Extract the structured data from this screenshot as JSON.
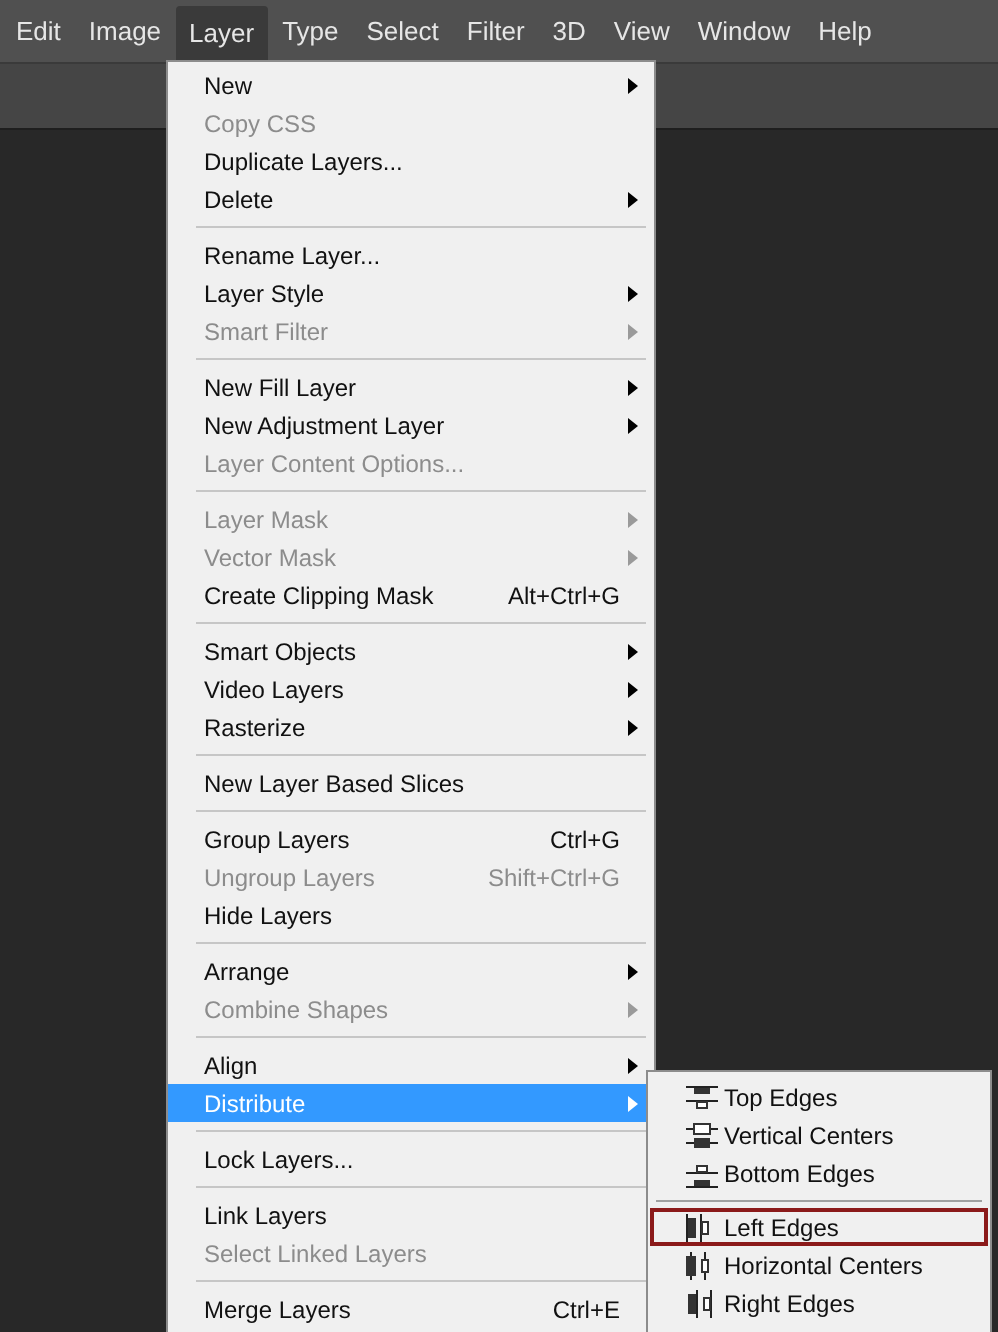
{
  "menubar": [
    {
      "label": "Edit",
      "selected": false
    },
    {
      "label": "Image",
      "selected": false
    },
    {
      "label": "Layer",
      "selected": true
    },
    {
      "label": "Type",
      "selected": false
    },
    {
      "label": "Select",
      "selected": false
    },
    {
      "label": "Filter",
      "selected": false
    },
    {
      "label": "3D",
      "selected": false
    },
    {
      "label": "View",
      "selected": false
    },
    {
      "label": "Window",
      "selected": false
    },
    {
      "label": "Help",
      "selected": false
    }
  ],
  "layer_menu": {
    "groups": [
      [
        {
          "label": "New",
          "disabled": false,
          "submenu": true,
          "selected": false
        },
        {
          "label": "Copy CSS",
          "disabled": true,
          "submenu": false,
          "selected": false
        },
        {
          "label": "Duplicate Layers...",
          "disabled": false,
          "submenu": false,
          "selected": false
        },
        {
          "label": "Delete",
          "disabled": false,
          "submenu": true,
          "selected": false
        }
      ],
      [
        {
          "label": "Rename Layer...",
          "disabled": false,
          "submenu": false,
          "selected": false
        },
        {
          "label": "Layer Style",
          "disabled": false,
          "submenu": true,
          "selected": false
        },
        {
          "label": "Smart Filter",
          "disabled": true,
          "submenu": true,
          "selected": false
        }
      ],
      [
        {
          "label": "New Fill Layer",
          "disabled": false,
          "submenu": true,
          "selected": false
        },
        {
          "label": "New Adjustment Layer",
          "disabled": false,
          "submenu": true,
          "selected": false
        },
        {
          "label": "Layer Content Options...",
          "disabled": true,
          "submenu": false,
          "selected": false
        }
      ],
      [
        {
          "label": "Layer Mask",
          "disabled": true,
          "submenu": true,
          "selected": false
        },
        {
          "label": "Vector Mask",
          "disabled": true,
          "submenu": true,
          "selected": false
        },
        {
          "label": "Create Clipping Mask",
          "disabled": false,
          "submenu": false,
          "shortcut": "Alt+Ctrl+G",
          "selected": false
        }
      ],
      [
        {
          "label": "Smart Objects",
          "disabled": false,
          "submenu": true,
          "selected": false
        },
        {
          "label": "Video Layers",
          "disabled": false,
          "submenu": true,
          "selected": false
        },
        {
          "label": "Rasterize",
          "disabled": false,
          "submenu": true,
          "selected": false
        }
      ],
      [
        {
          "label": "New Layer Based Slices",
          "disabled": false,
          "submenu": false,
          "selected": false
        }
      ],
      [
        {
          "label": "Group Layers",
          "disabled": false,
          "submenu": false,
          "shortcut": "Ctrl+G",
          "selected": false
        },
        {
          "label": "Ungroup Layers",
          "disabled": true,
          "submenu": false,
          "shortcut": "Shift+Ctrl+G",
          "selected": false
        },
        {
          "label": "Hide Layers",
          "disabled": false,
          "submenu": false,
          "selected": false
        }
      ],
      [
        {
          "label": "Arrange",
          "disabled": false,
          "submenu": true,
          "selected": false
        },
        {
          "label": "Combine Shapes",
          "disabled": true,
          "submenu": true,
          "selected": false
        }
      ],
      [
        {
          "label": "Align",
          "disabled": false,
          "submenu": true,
          "selected": false
        },
        {
          "label": "Distribute",
          "disabled": false,
          "submenu": true,
          "selected": true
        }
      ],
      [
        {
          "label": "Lock Layers...",
          "disabled": false,
          "submenu": false,
          "selected": false
        }
      ],
      [
        {
          "label": "Link Layers",
          "disabled": false,
          "submenu": false,
          "selected": false
        },
        {
          "label": "Select Linked Layers",
          "disabled": true,
          "submenu": false,
          "selected": false
        }
      ],
      [
        {
          "label": "Merge Layers",
          "disabled": false,
          "submenu": false,
          "shortcut": "Ctrl+E",
          "selected": false
        }
      ]
    ]
  },
  "distribute_submenu": {
    "groups": [
      [
        {
          "label": "Top Edges",
          "highlighted": false
        },
        {
          "label": "Vertical Centers",
          "highlighted": false
        },
        {
          "label": "Bottom Edges",
          "highlighted": false
        }
      ],
      [
        {
          "label": "Left Edges",
          "highlighted": true
        },
        {
          "label": "Horizontal Centers",
          "highlighted": false
        },
        {
          "label": "Right Edges",
          "highlighted": false
        }
      ]
    ]
  }
}
